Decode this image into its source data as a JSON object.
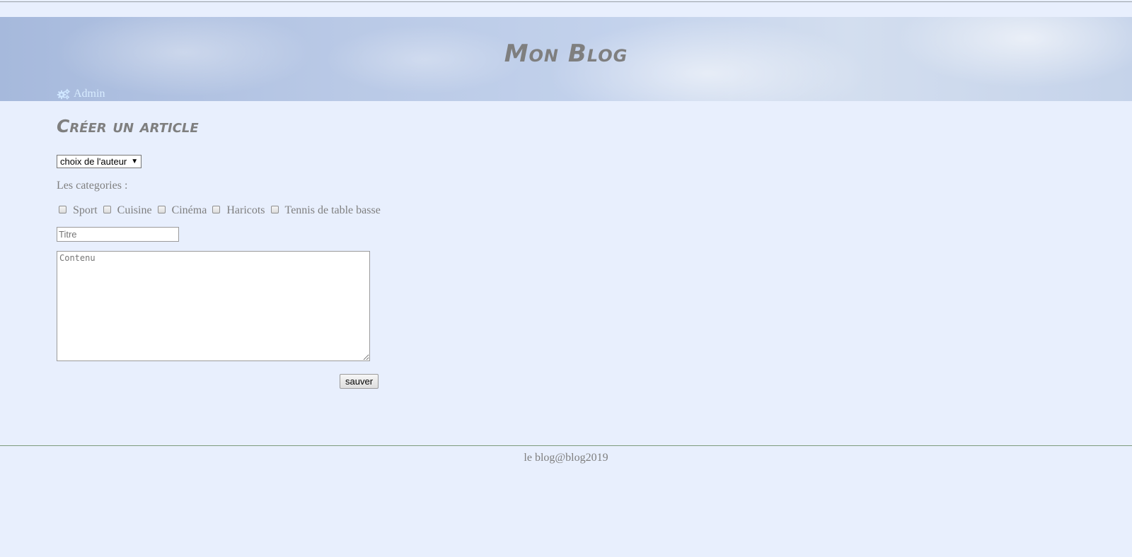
{
  "header": {
    "site_title": "Mon Blog",
    "admin_link": "Admin",
    "admin_icon": "cogs-icon"
  },
  "main": {
    "heading": "Créer un article",
    "author_select": {
      "selected": "choix de l'auteur"
    },
    "categories_label": "Les categories :",
    "categories": [
      {
        "label": "Sport",
        "checked": false
      },
      {
        "label": "Cuisine",
        "checked": false
      },
      {
        "label": "Cinéma",
        "checked": false
      },
      {
        "label": "Haricots",
        "checked": false
      },
      {
        "label": "Tennis de table basse",
        "checked": false
      }
    ],
    "title_input": {
      "placeholder": "Titre",
      "value": ""
    },
    "content_textarea": {
      "placeholder": "Contenu",
      "value": ""
    },
    "save_label": "sauver"
  },
  "footer": {
    "text": "le blog@blog2019"
  },
  "colors": {
    "page_background": "#e8effd",
    "heading_text": "#7f7f7f",
    "admin_link": "#d8ecff"
  }
}
